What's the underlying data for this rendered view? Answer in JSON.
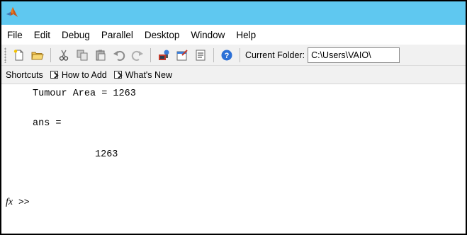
{
  "menu": [
    "File",
    "Edit",
    "Debug",
    "Parallel",
    "Desktop",
    "Window",
    "Help"
  ],
  "toolbar": {
    "folder_label": "Current Folder:",
    "folder_value": "C:\\Users\\VAIO\\"
  },
  "shortcuts": {
    "label": "Shortcuts",
    "how_to_add": "How to Add",
    "whats_new": "What's New"
  },
  "console": {
    "line1": "Tumour Area = 1263",
    "line2": "ans =",
    "line3": "1263",
    "fx_label": "fx",
    "prompt": ">>"
  },
  "colors": {
    "titlebar": "#5fc8f0",
    "toolbar_bg": "#f1f1f1"
  }
}
